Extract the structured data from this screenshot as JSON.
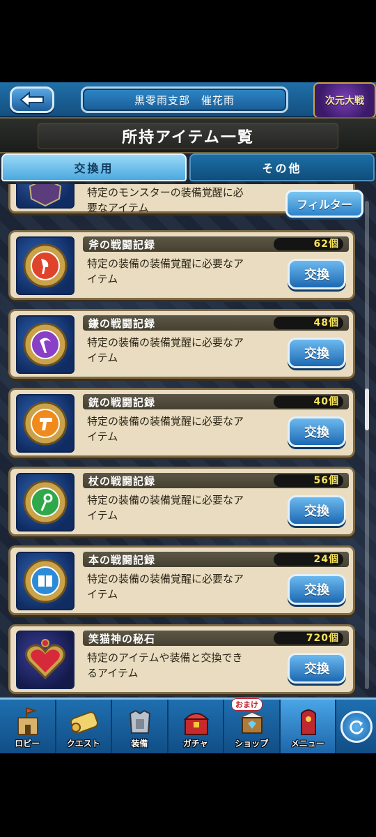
{
  "header": {
    "back_label": "",
    "guild_name": "黒零雨支部　催花雨",
    "event_badge": "次元大戦"
  },
  "page_title": "所持アイテム一覧",
  "tabs": [
    {
      "label": "交換用",
      "active": true
    },
    {
      "label": "その他",
      "active": false
    }
  ],
  "filter_label": "フィルター",
  "partial_item": {
    "desc_line1": "特定のモンスターの装備覚醒に必",
    "desc_line2": "要なアイテム"
  },
  "items": [
    {
      "name": "斧の戦闘記録",
      "count": "62個",
      "desc_line1": "特定の装備の装備覚醒に必要なア",
      "desc_line2": "イテム",
      "button": "交換",
      "icon": "axe-record-icon",
      "color": "#e0432c"
    },
    {
      "name": "鎌の戦闘記録",
      "count": "48個",
      "desc_line1": "特定の装備の装備覚醒に必要なア",
      "desc_line2": "イテム",
      "button": "交換",
      "icon": "scythe-record-icon",
      "color": "#8a3fc7"
    },
    {
      "name": "銃の戦闘記録",
      "count": "40個",
      "desc_line1": "特定の装備の装備覚醒に必要なア",
      "desc_line2": "イテム",
      "button": "交換",
      "icon": "gun-record-icon",
      "color": "#f08a1c"
    },
    {
      "name": "杖の戦闘記録",
      "count": "56個",
      "desc_line1": "特定の装備の装備覚醒に必要なア",
      "desc_line2": "イテム",
      "button": "交換",
      "icon": "staff-record-icon",
      "color": "#2fa84a"
    },
    {
      "name": "本の戦闘記録",
      "count": "24個",
      "desc_line1": "特定の装備の装備覚醒に必要なア",
      "desc_line2": "イテム",
      "button": "交換",
      "icon": "book-record-icon",
      "color": "#2c8bd8"
    },
    {
      "name": "笑猫神の秘石",
      "count": "720個",
      "desc_line1": "特定のアイテムや装備と交換でき",
      "desc_line2": "るアイテム",
      "button": "交換",
      "icon": "heart-stone-icon",
      "color": "#d62a3a"
    }
  ],
  "nav": [
    {
      "label": "ロビー",
      "icon": "lobby-castle-icon"
    },
    {
      "label": "クエスト",
      "icon": "quest-scroll-icon"
    },
    {
      "label": "装備",
      "icon": "armor-icon"
    },
    {
      "label": "ガチャ",
      "icon": "treasure-chest-icon"
    },
    {
      "label": "ショップ",
      "icon": "shop-stall-icon",
      "badge": "おまけ"
    },
    {
      "label": "メニュー",
      "icon": "menu-door-icon",
      "active": true
    }
  ],
  "refresh_icon": "refresh-icon",
  "scroll_position": 0.42
}
